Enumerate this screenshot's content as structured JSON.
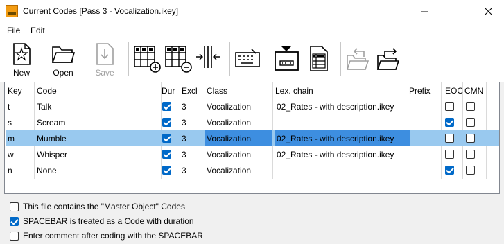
{
  "window": {
    "title": "Current Codes [Pass 3 - Vocalization.ikey]"
  },
  "menu": [
    "File",
    "Edit"
  ],
  "toolbar": {
    "new": "New",
    "open": "Open",
    "save": "Save"
  },
  "table": {
    "headers": [
      "Key",
      "Code",
      "Dur",
      "Excl",
      "Class",
      "Lex. chain",
      "Prefix",
      "EOC",
      "CMN"
    ],
    "rows": [
      {
        "key": "t",
        "code": "Talk",
        "dur": true,
        "excl": "3",
        "class": "Vocalization",
        "lex": "02_Rates - with description.ikey",
        "prefix": "",
        "eoc": false,
        "cmn": false,
        "selected": false
      },
      {
        "key": "s",
        "code": "Scream",
        "dur": true,
        "excl": "3",
        "class": "Vocalization",
        "lex": "",
        "prefix": "",
        "eoc": true,
        "cmn": false,
        "selected": false
      },
      {
        "key": "m",
        "code": "Mumble",
        "dur": true,
        "excl": "3",
        "class": "Vocalization",
        "lex": "02_Rates - with description.ikey",
        "prefix": "",
        "eoc": false,
        "cmn": false,
        "selected": true
      },
      {
        "key": "w",
        "code": "Whisper",
        "dur": true,
        "excl": "3",
        "class": "Vocalization",
        "lex": "02_Rates - with description.ikey",
        "prefix": "",
        "eoc": false,
        "cmn": false,
        "selected": false
      },
      {
        "key": "n",
        "code": "None",
        "dur": true,
        "excl": "3",
        "class": "Vocalization",
        "lex": "",
        "prefix": "",
        "eoc": true,
        "cmn": false,
        "selected": false
      }
    ]
  },
  "options": [
    {
      "label": "This file contains the \"Master Object\" Codes",
      "checked": false
    },
    {
      "label": "SPACEBAR is treated as a Code with duration",
      "checked": true
    },
    {
      "label": "Enter comment after coding with the SPACEBAR",
      "checked": false
    }
  ],
  "colors": {
    "selection_row": "#99c9ef",
    "selection_cell": "#3d8ee0",
    "checkbox_on": "#0069c8"
  }
}
